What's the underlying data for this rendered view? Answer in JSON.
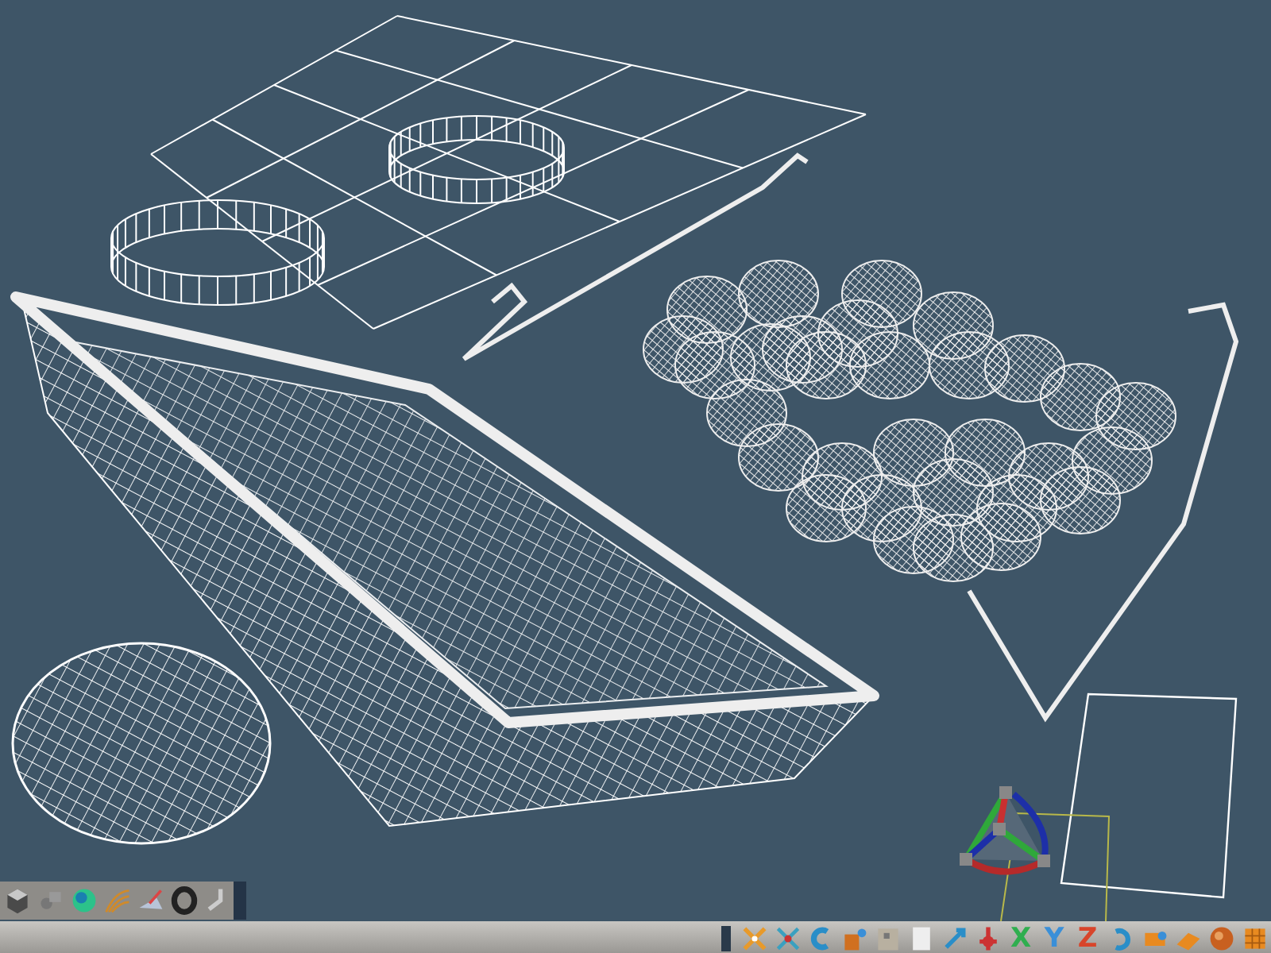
{
  "bottom_toolbar": {
    "axis_buttons": [
      {
        "label": "X",
        "color": "#2fae4f"
      },
      {
        "label": "Y",
        "color": "#3a8fd8"
      },
      {
        "label": "Z",
        "color": "#d8452b"
      }
    ]
  }
}
